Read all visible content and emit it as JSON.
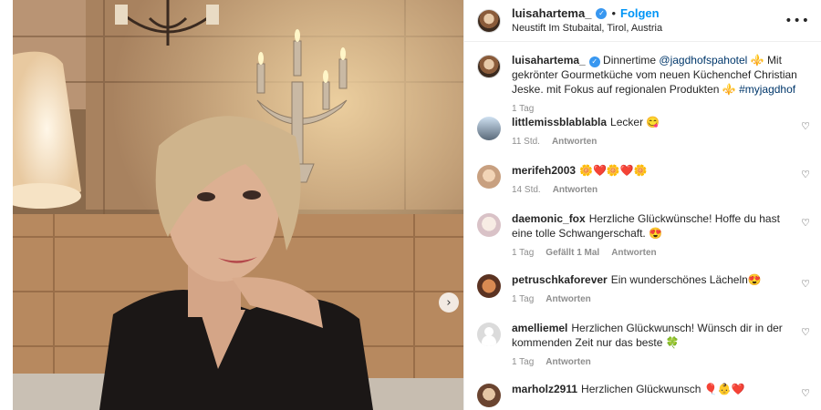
{
  "post": {
    "username": "luisahartema_",
    "separator": "•",
    "follow_label": "Folgen",
    "location": "Neustift Im Stubaital, Tirol, Austria",
    "more_icon": "more-options-icon",
    "next_icon": "chevron-right-icon"
  },
  "caption": {
    "username": "luisahartema_",
    "text_before": " Dinnertime ",
    "mention": "@jagdhofspahotel",
    "text_after": " ⚜️ Mit gekrönter Gourmetküche vom neuen Küchenchef Christian Jeske. mit Fokus auf regionalen Produkten ⚜️ ",
    "hashtag": "#myjagdhof",
    "time": "1 Tag"
  },
  "comments": [
    {
      "user": "littlemissblablabla",
      "text": "Lecker 😋",
      "time": "11 Std.",
      "likes": "",
      "reply": "Antworten"
    },
    {
      "user": "merifeh2003",
      "text": "🌼❤️🌼❤️🌼",
      "time": "14 Std.",
      "likes": "",
      "reply": "Antworten"
    },
    {
      "user": "daemonic_fox",
      "text": "Herzliche Glückwünsche! Hoffe du hast eine tolle Schwangerschaft. 😍",
      "time": "1 Tag",
      "likes": "Gefällt 1 Mal",
      "reply": "Antworten"
    },
    {
      "user": "petruschkaforever",
      "text": "Ein wunderschönes Lächeln😍",
      "time": "1 Tag",
      "likes": "",
      "reply": "Antworten"
    },
    {
      "user": "amelliemel",
      "text": "Herzlichen Glückwunsch! Wünsch dir in der kommenden Zeit nur das beste 🍀",
      "time": "1 Tag",
      "likes": "",
      "reply": "Antworten"
    },
    {
      "user": "marholz2911",
      "text": "Herzlichen Glückwunsch 🎈👶❤️",
      "time": "",
      "likes": "",
      "reply": ""
    }
  ],
  "colors": {
    "accent": "#0095f6",
    "verified": "#3897f0",
    "muted": "#8e8e8e"
  }
}
